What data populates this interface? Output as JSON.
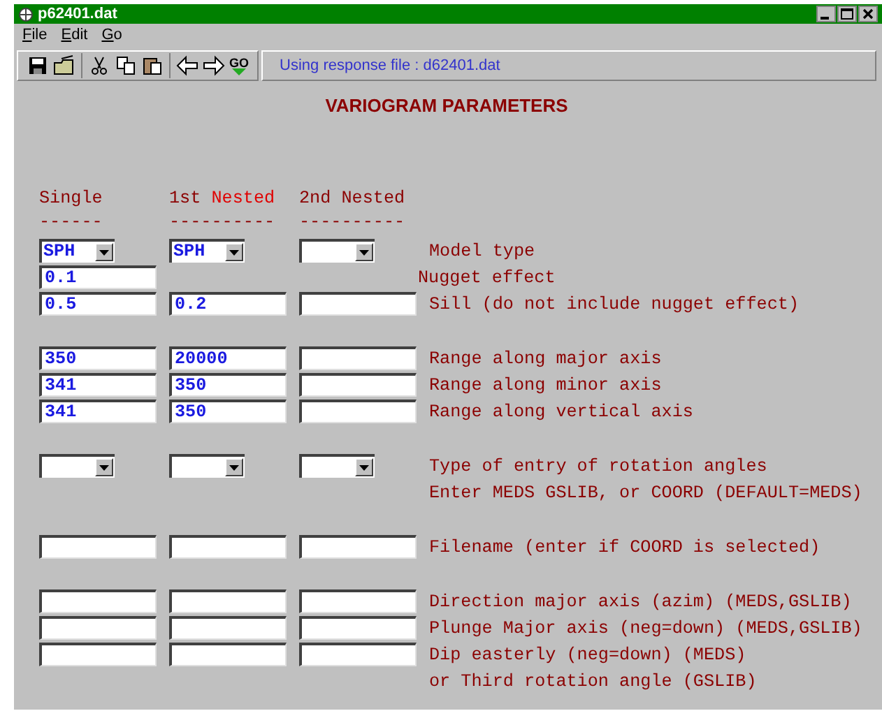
{
  "window": {
    "title": "p62401.dat"
  },
  "menu": [
    {
      "label": "File"
    },
    {
      "label": "Edit"
    },
    {
      "label": "Go"
    }
  ],
  "toolbar": {
    "groups": [
      [
        {
          "kind": "save"
        },
        {
          "kind": "open"
        }
      ],
      [
        {
          "kind": "cut"
        },
        {
          "kind": "copy"
        },
        {
          "kind": "paste"
        }
      ],
      [
        {
          "kind": "back"
        },
        {
          "kind": "forward"
        },
        {
          "kind": "go",
          "text": "GO"
        }
      ]
    ],
    "status": "Using response file : d62401.dat"
  },
  "heading": "VARIOGRAM PARAMETERS",
  "columns": [
    {
      "parts": [
        {
          "text": "Single",
          "highlighted": false
        }
      ],
      "rule": "------"
    },
    {
      "parts": [
        {
          "text": "1st ",
          "highlighted": false
        },
        {
          "text": "Nested",
          "highlighted": true
        }
      ],
      "rule": "----------"
    },
    {
      "parts": [
        {
          "text": "2nd Nested",
          "highlighted": false
        }
      ],
      "rule": "----------"
    }
  ],
  "sections": [
    [
      {
        "cells": [
          {
            "kind": "dropdown",
            "value": "SPH"
          },
          {
            "kind": "dropdown",
            "value": "SPH"
          },
          {
            "kind": "dropdown"
          }
        ],
        "label": "Model type"
      },
      {
        "cells": [
          {
            "kind": "text",
            "value": "0.1"
          },
          {
            "kind": "none"
          },
          {
            "kind": "none"
          }
        ],
        "label": "Nugget effect"
      },
      {
        "cells": [
          {
            "kind": "text",
            "value": "0.5"
          },
          {
            "kind": "text",
            "value": "0.2"
          },
          {
            "kind": "text"
          }
        ],
        "label": "Sill (do not include nugget effect)"
      }
    ],
    [
      {
        "cells": [
          {
            "kind": "text",
            "value": "350"
          },
          {
            "kind": "text",
            "value": "20000"
          },
          {
            "kind": "text"
          }
        ],
        "label": "Range along major axis"
      },
      {
        "cells": [
          {
            "kind": "text",
            "value": "341"
          },
          {
            "kind": "text",
            "value": "350"
          },
          {
            "kind": "text"
          }
        ],
        "label": "Range along minor axis"
      },
      {
        "cells": [
          {
            "kind": "text",
            "value": "341"
          },
          {
            "kind": "text",
            "value": "350"
          },
          {
            "kind": "text"
          }
        ],
        "label": "Range along vertical axis"
      }
    ],
    [
      {
        "cells": [
          {
            "kind": "dropdown"
          },
          {
            "kind": "dropdown"
          },
          {
            "kind": "dropdown"
          }
        ],
        "label": "Type of entry of rotation angles"
      },
      {
        "label": "Enter MEDS GSLIB, or COORD (DEFAULT=MEDS)"
      }
    ],
    [
      {
        "cells": [
          {
            "kind": "text"
          },
          {
            "kind": "text"
          },
          {
            "kind": "text"
          }
        ],
        "label": "Filename (enter if COORD is selected)"
      }
    ],
    [
      {
        "cells": [
          {
            "kind": "text"
          },
          {
            "kind": "text"
          },
          {
            "kind": "text"
          }
        ],
        "label": "Direction major axis (azim) (MEDS,GSLIB)"
      },
      {
        "cells": [
          {
            "kind": "text"
          },
          {
            "kind": "text"
          },
          {
            "kind": "text"
          }
        ],
        "label": "Plunge Major axis (neg=down) (MEDS,GSLIB)"
      },
      {
        "cells": [
          {
            "kind": "text"
          },
          {
            "kind": "text"
          },
          {
            "kind": "text"
          }
        ],
        "label": "Dip easterly (neg=down) (MEDS)"
      },
      {
        "label": "or Third rotation angle (GSLIB)"
      }
    ]
  ]
}
